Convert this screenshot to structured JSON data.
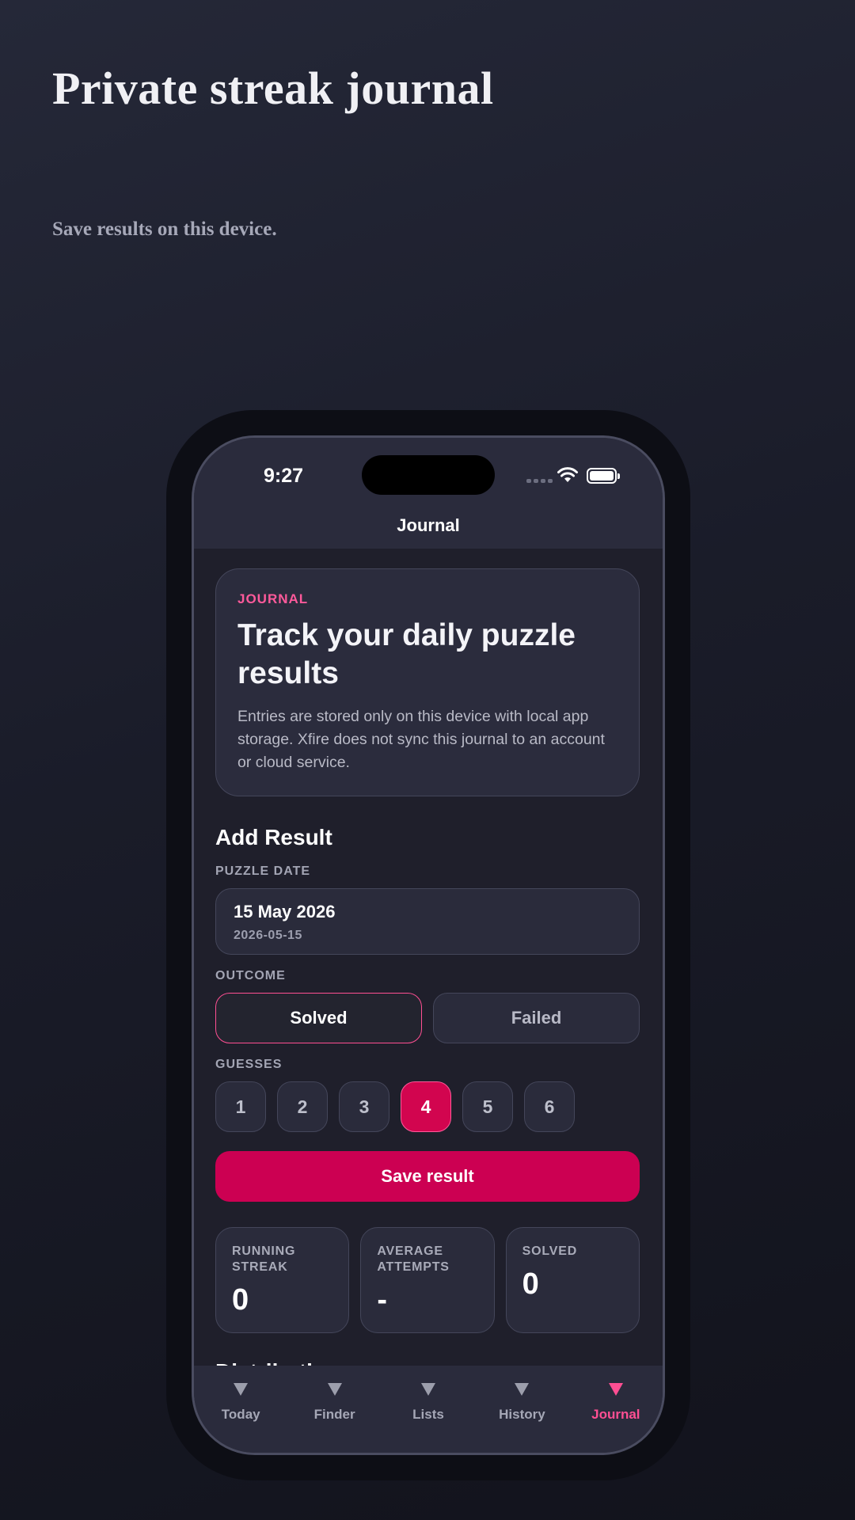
{
  "hero": {
    "title": "Private streak journal",
    "subtitle": "Save results on this device."
  },
  "status_bar": {
    "time": "9:27"
  },
  "nav": {
    "title": "Journal"
  },
  "intro": {
    "eyebrow": "JOURNAL",
    "title": "Track your daily puzzle results",
    "body": "Entries are stored only on this device with local app storage. Xfire does not sync this journal to an account or cloud service."
  },
  "add_result": {
    "heading": "Add Result",
    "date_label": "PUZZLE DATE",
    "date_display": "15 May 2026",
    "date_iso": "2026-05-15",
    "outcome_label": "OUTCOME",
    "outcomes": [
      {
        "label": "Solved",
        "selected": true
      },
      {
        "label": "Failed",
        "selected": false
      }
    ],
    "guesses_label": "GUESSES",
    "guesses": [
      "1",
      "2",
      "3",
      "4",
      "5",
      "6"
    ],
    "selected_guess": "4",
    "save_label": "Save result"
  },
  "stats": [
    {
      "label": "RUNNING STREAK",
      "value": "0"
    },
    {
      "label": "AVERAGE ATTEMPTS",
      "value": "-"
    },
    {
      "label": "SOLVED",
      "value": "0"
    }
  ],
  "partial_heading": "Distribution",
  "tabs": [
    {
      "label": "Today",
      "icon": "triangle-down-icon",
      "active": false
    },
    {
      "label": "Finder",
      "icon": "triangle-down-icon",
      "active": false
    },
    {
      "label": "Lists",
      "icon": "triangle-down-icon",
      "active": false
    },
    {
      "label": "History",
      "icon": "triangle-down-icon",
      "active": false
    },
    {
      "label": "Journal",
      "icon": "triangle-down-icon",
      "active": true
    }
  ],
  "colors": {
    "accent": "#ff4f93",
    "primary_button": "#cc0052"
  }
}
